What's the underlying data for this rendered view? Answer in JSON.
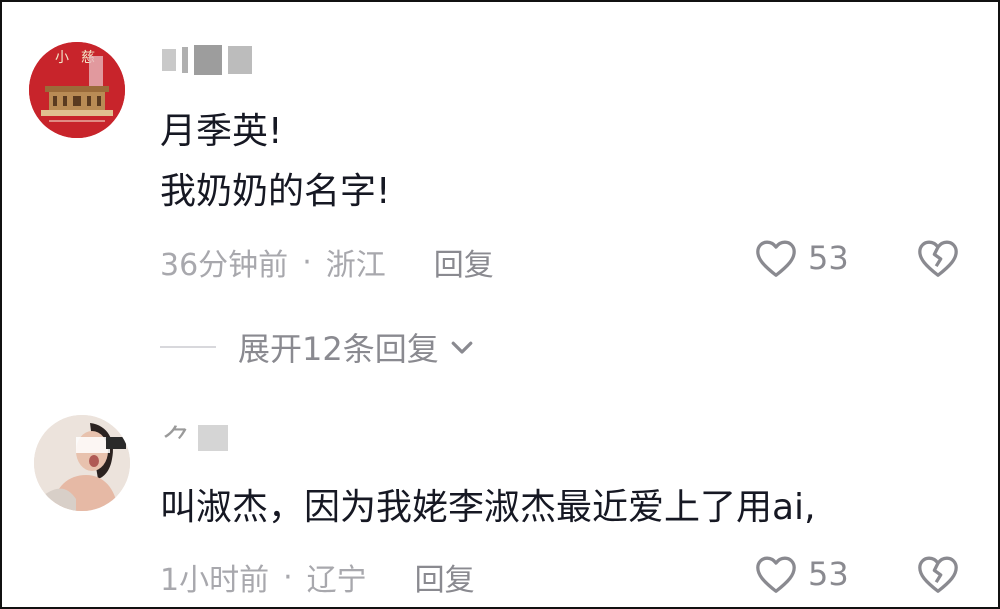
{
  "comments": [
    {
      "username": "",
      "text_lines": [
        "月季英!",
        "我奶奶的名字!"
      ],
      "time": "36分钟前",
      "separator": "·",
      "location": "浙江",
      "reply_label": "回复",
      "likes": "53",
      "avatar_icon": "tiananmen-avatar-icon"
    },
    {
      "username": "",
      "text_lines": [
        "叫淑杰，因为我姥李淑杰最近爱上了用ai,"
      ],
      "time": "1小时前",
      "separator": "·",
      "location": "辽宁",
      "reply_label": "回复",
      "likes": "53",
      "avatar_icon": "person-avatar-icon"
    }
  ],
  "expand_replies": {
    "label": "展开12条回复"
  },
  "colors": {
    "meta_gray": "#a8a8ad",
    "text": "#161823",
    "avatar_red": "#c8242b"
  }
}
